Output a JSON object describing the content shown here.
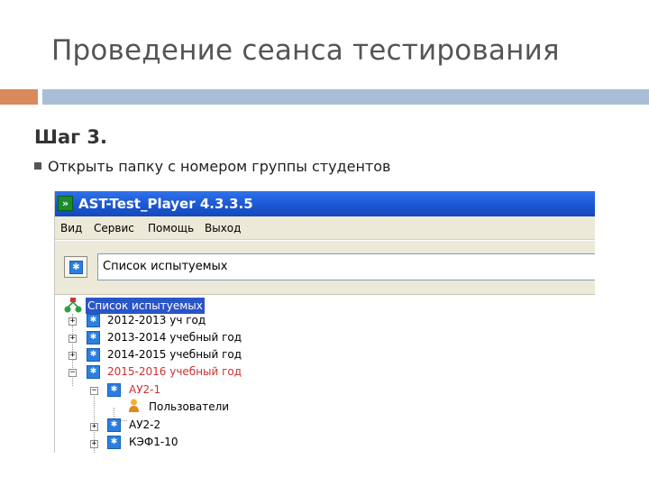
{
  "slide": {
    "title": "Проведение сеанса тестирования",
    "step": "Шаг 3.",
    "bullet": "Открыть папку с номером группы студентов"
  },
  "app": {
    "title": "AST-Test_Player  4.3.3.5",
    "menu": [
      "Вид",
      "Сервис",
      "Помощь",
      "Выход"
    ],
    "address_value": "Список испытуемых",
    "tree": {
      "root": "Список испытуемых",
      "items": [
        {
          "label": "2012-2013 уч год",
          "expanded": false,
          "color": "normal"
        },
        {
          "label": "2013-2014 учебный год",
          "expanded": false,
          "color": "normal"
        },
        {
          "label": "2014-2015 учебный год",
          "expanded": false,
          "color": "normal"
        },
        {
          "label": "2015-2016 учебный год",
          "expanded": true,
          "color": "red"
        }
      ],
      "children": [
        {
          "label": "АУ2-1",
          "expanded": true,
          "color": "red"
        },
        {
          "label": "Пользователи",
          "color": "normal"
        },
        {
          "label": "АУ2-2",
          "expanded": false,
          "color": "normal"
        },
        {
          "label": "КЭФ1-10",
          "expanded": false,
          "color": "normal"
        }
      ]
    }
  },
  "colors": {
    "accent_orange": "#d98a5d",
    "accent_blue": "#a9bdd6",
    "titlebar": "#1b57d3",
    "highlight_red": "#d03030",
    "selection": "#2a55c8"
  },
  "icons": [
    "app-logo-icon",
    "folder-star-icon",
    "users-root-icon",
    "user-icon"
  ]
}
